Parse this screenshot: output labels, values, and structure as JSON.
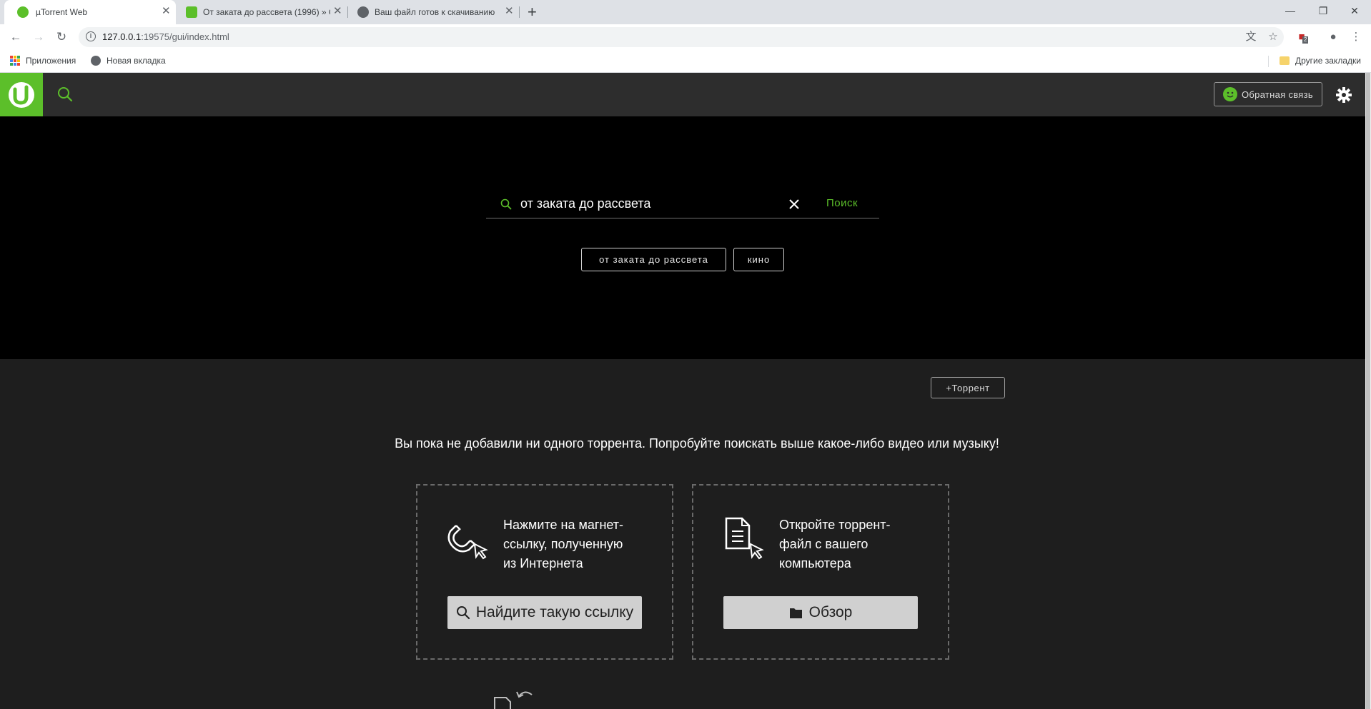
{
  "browser": {
    "tabs": [
      {
        "title": "µTorrent Web",
        "active": true
      },
      {
        "title": "От заката до рассвета (1996) » С",
        "active": false
      },
      {
        "title": "Ваш файл готов к скачиванию",
        "active": false
      }
    ],
    "url_host": "127.0.0.1",
    "url_rest": ":19575/gui/index.html",
    "extension_badge": "2",
    "bookmarks": {
      "apps": "Приложения",
      "new_tab": "Новая вкладка",
      "other": "Другие закладки"
    }
  },
  "app": {
    "feedback_label": "Обратная связь",
    "search": {
      "query": "от заката до рассвета",
      "button": "Поиск",
      "suggestions": [
        "от заката до рассвета",
        "кино"
      ]
    },
    "add_torrent_label": "+Торрент",
    "empty_message": "Вы пока не добавили ни одного торрента. Попробуйте поискать выше какое-либо видео или музыку!",
    "cards": {
      "magnet": {
        "line1": "Нажмите на магнет-",
        "line2": "ссылку, полученную",
        "line3": "из Интернета",
        "button": "Найдите такую ссылку"
      },
      "file": {
        "line1": "Откройте торрент-",
        "line2": "файл с вашего",
        "line3": "компьютера",
        "button": "Обзор"
      }
    }
  },
  "colors": {
    "brand_green": "#5cbf2a",
    "hero_bg": "#000000",
    "content_bg": "#1e1e1e",
    "header_bg": "#2d2d2d"
  },
  "icons": [
    "search-icon",
    "close-icon",
    "gear-icon",
    "magnet-icon",
    "document-icon",
    "folder-icon",
    "utorrent-logo"
  ]
}
